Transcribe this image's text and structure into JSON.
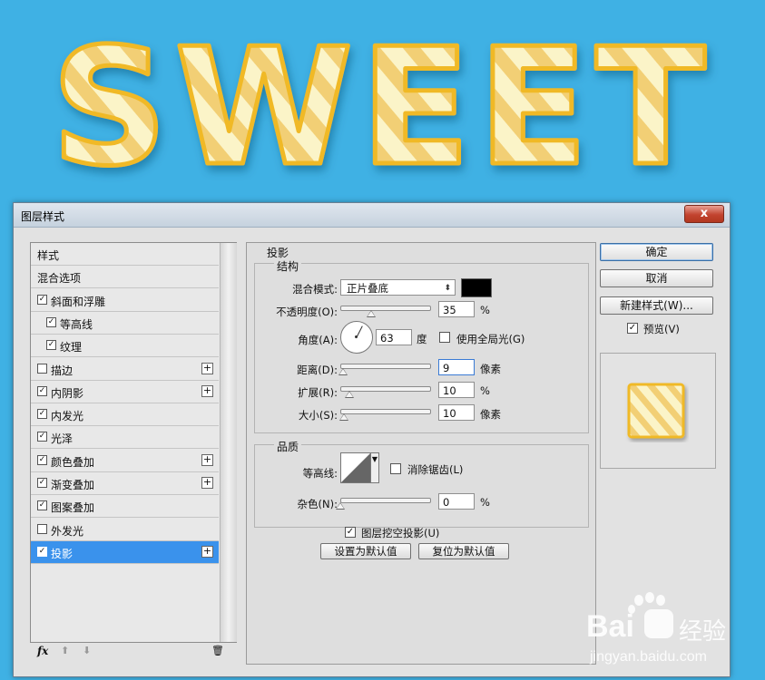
{
  "banner": {
    "text": "SWEET"
  },
  "dialog": {
    "title": "图层样式",
    "close_label": "x",
    "style_list": [
      {
        "label": "样式",
        "checkbox": false,
        "checked": false,
        "plus": false,
        "selected": false,
        "indent": false
      },
      {
        "label": "混合选项",
        "checkbox": false,
        "checked": false,
        "plus": false,
        "selected": false,
        "indent": false
      },
      {
        "label": "斜面和浮雕",
        "checkbox": true,
        "checked": true,
        "plus": false,
        "selected": false,
        "indent": false
      },
      {
        "label": "等高线",
        "checkbox": true,
        "checked": true,
        "plus": false,
        "selected": false,
        "indent": true
      },
      {
        "label": "纹理",
        "checkbox": true,
        "checked": true,
        "plus": false,
        "selected": false,
        "indent": true
      },
      {
        "label": "描边",
        "checkbox": true,
        "checked": false,
        "plus": true,
        "selected": false,
        "indent": false
      },
      {
        "label": "内阴影",
        "checkbox": true,
        "checked": true,
        "plus": true,
        "selected": false,
        "indent": false
      },
      {
        "label": "内发光",
        "checkbox": true,
        "checked": true,
        "plus": false,
        "selected": false,
        "indent": false
      },
      {
        "label": "光泽",
        "checkbox": true,
        "checked": true,
        "plus": false,
        "selected": false,
        "indent": false
      },
      {
        "label": "颜色叠加",
        "checkbox": true,
        "checked": true,
        "plus": true,
        "selected": false,
        "indent": false
      },
      {
        "label": "渐变叠加",
        "checkbox": true,
        "checked": true,
        "plus": true,
        "selected": false,
        "indent": false
      },
      {
        "label": "图案叠加",
        "checkbox": true,
        "checked": true,
        "plus": false,
        "selected": false,
        "indent": false
      },
      {
        "label": "外发光",
        "checkbox": true,
        "checked": false,
        "plus": false,
        "selected": false,
        "indent": false
      },
      {
        "label": "投影",
        "checkbox": true,
        "checked": true,
        "plus": true,
        "selected": true,
        "indent": false
      }
    ],
    "footer": {
      "fx": "fx",
      "up": "⬆",
      "down": "⬇",
      "trash": "🗑"
    },
    "panel": {
      "section_title": "投影",
      "structure": {
        "title": "结构",
        "blend_mode_label": "混合模式:",
        "blend_mode_value": "正片叠底",
        "blend_color": "#000000",
        "opacity_label": "不透明度(O):",
        "opacity_value": "35",
        "opacity_unit": "%",
        "opacity_level": 0.35,
        "angle_label": "角度(A):",
        "angle_value": "63",
        "angle_unit": "度",
        "global_light_label": "使用全局光(G)",
        "global_light_checked": false,
        "distance_label": "距离(D):",
        "distance_value": "9",
        "distance_unit": "像素",
        "distance_level": 0.03,
        "spread_label": "扩展(R):",
        "spread_value": "10",
        "spread_unit": "%",
        "spread_level": 0.1,
        "size_label": "大小(S):",
        "size_value": "10",
        "size_unit": "像素",
        "size_level": 0.04
      },
      "quality": {
        "title": "品质",
        "contour_label": "等高线:",
        "antialias_label": "消除锯齿(L)",
        "antialias_checked": false,
        "noise_label": "杂色(N):",
        "noise_value": "0",
        "noise_unit": "%",
        "noise_level": 0
      },
      "knockout_label": "图层挖空投影(U)",
      "knockout_checked": true,
      "set_default_label": "设置为默认值",
      "reset_default_label": "复位为默认值"
    },
    "buttons": {
      "ok": "确定",
      "cancel": "取消",
      "new_style": "新建样式(W)...",
      "preview_label": "预览(V)",
      "preview_checked": true
    }
  },
  "watermark": {
    "brand": "Bai",
    "brand2": "经验",
    "url": "jingyan.baidu.com"
  },
  "colors": {
    "background": "#3fb1e4",
    "selection": "#3a92ec",
    "candy_yellow": "#f5c842",
    "candy_cream": "#fbf4c8"
  }
}
